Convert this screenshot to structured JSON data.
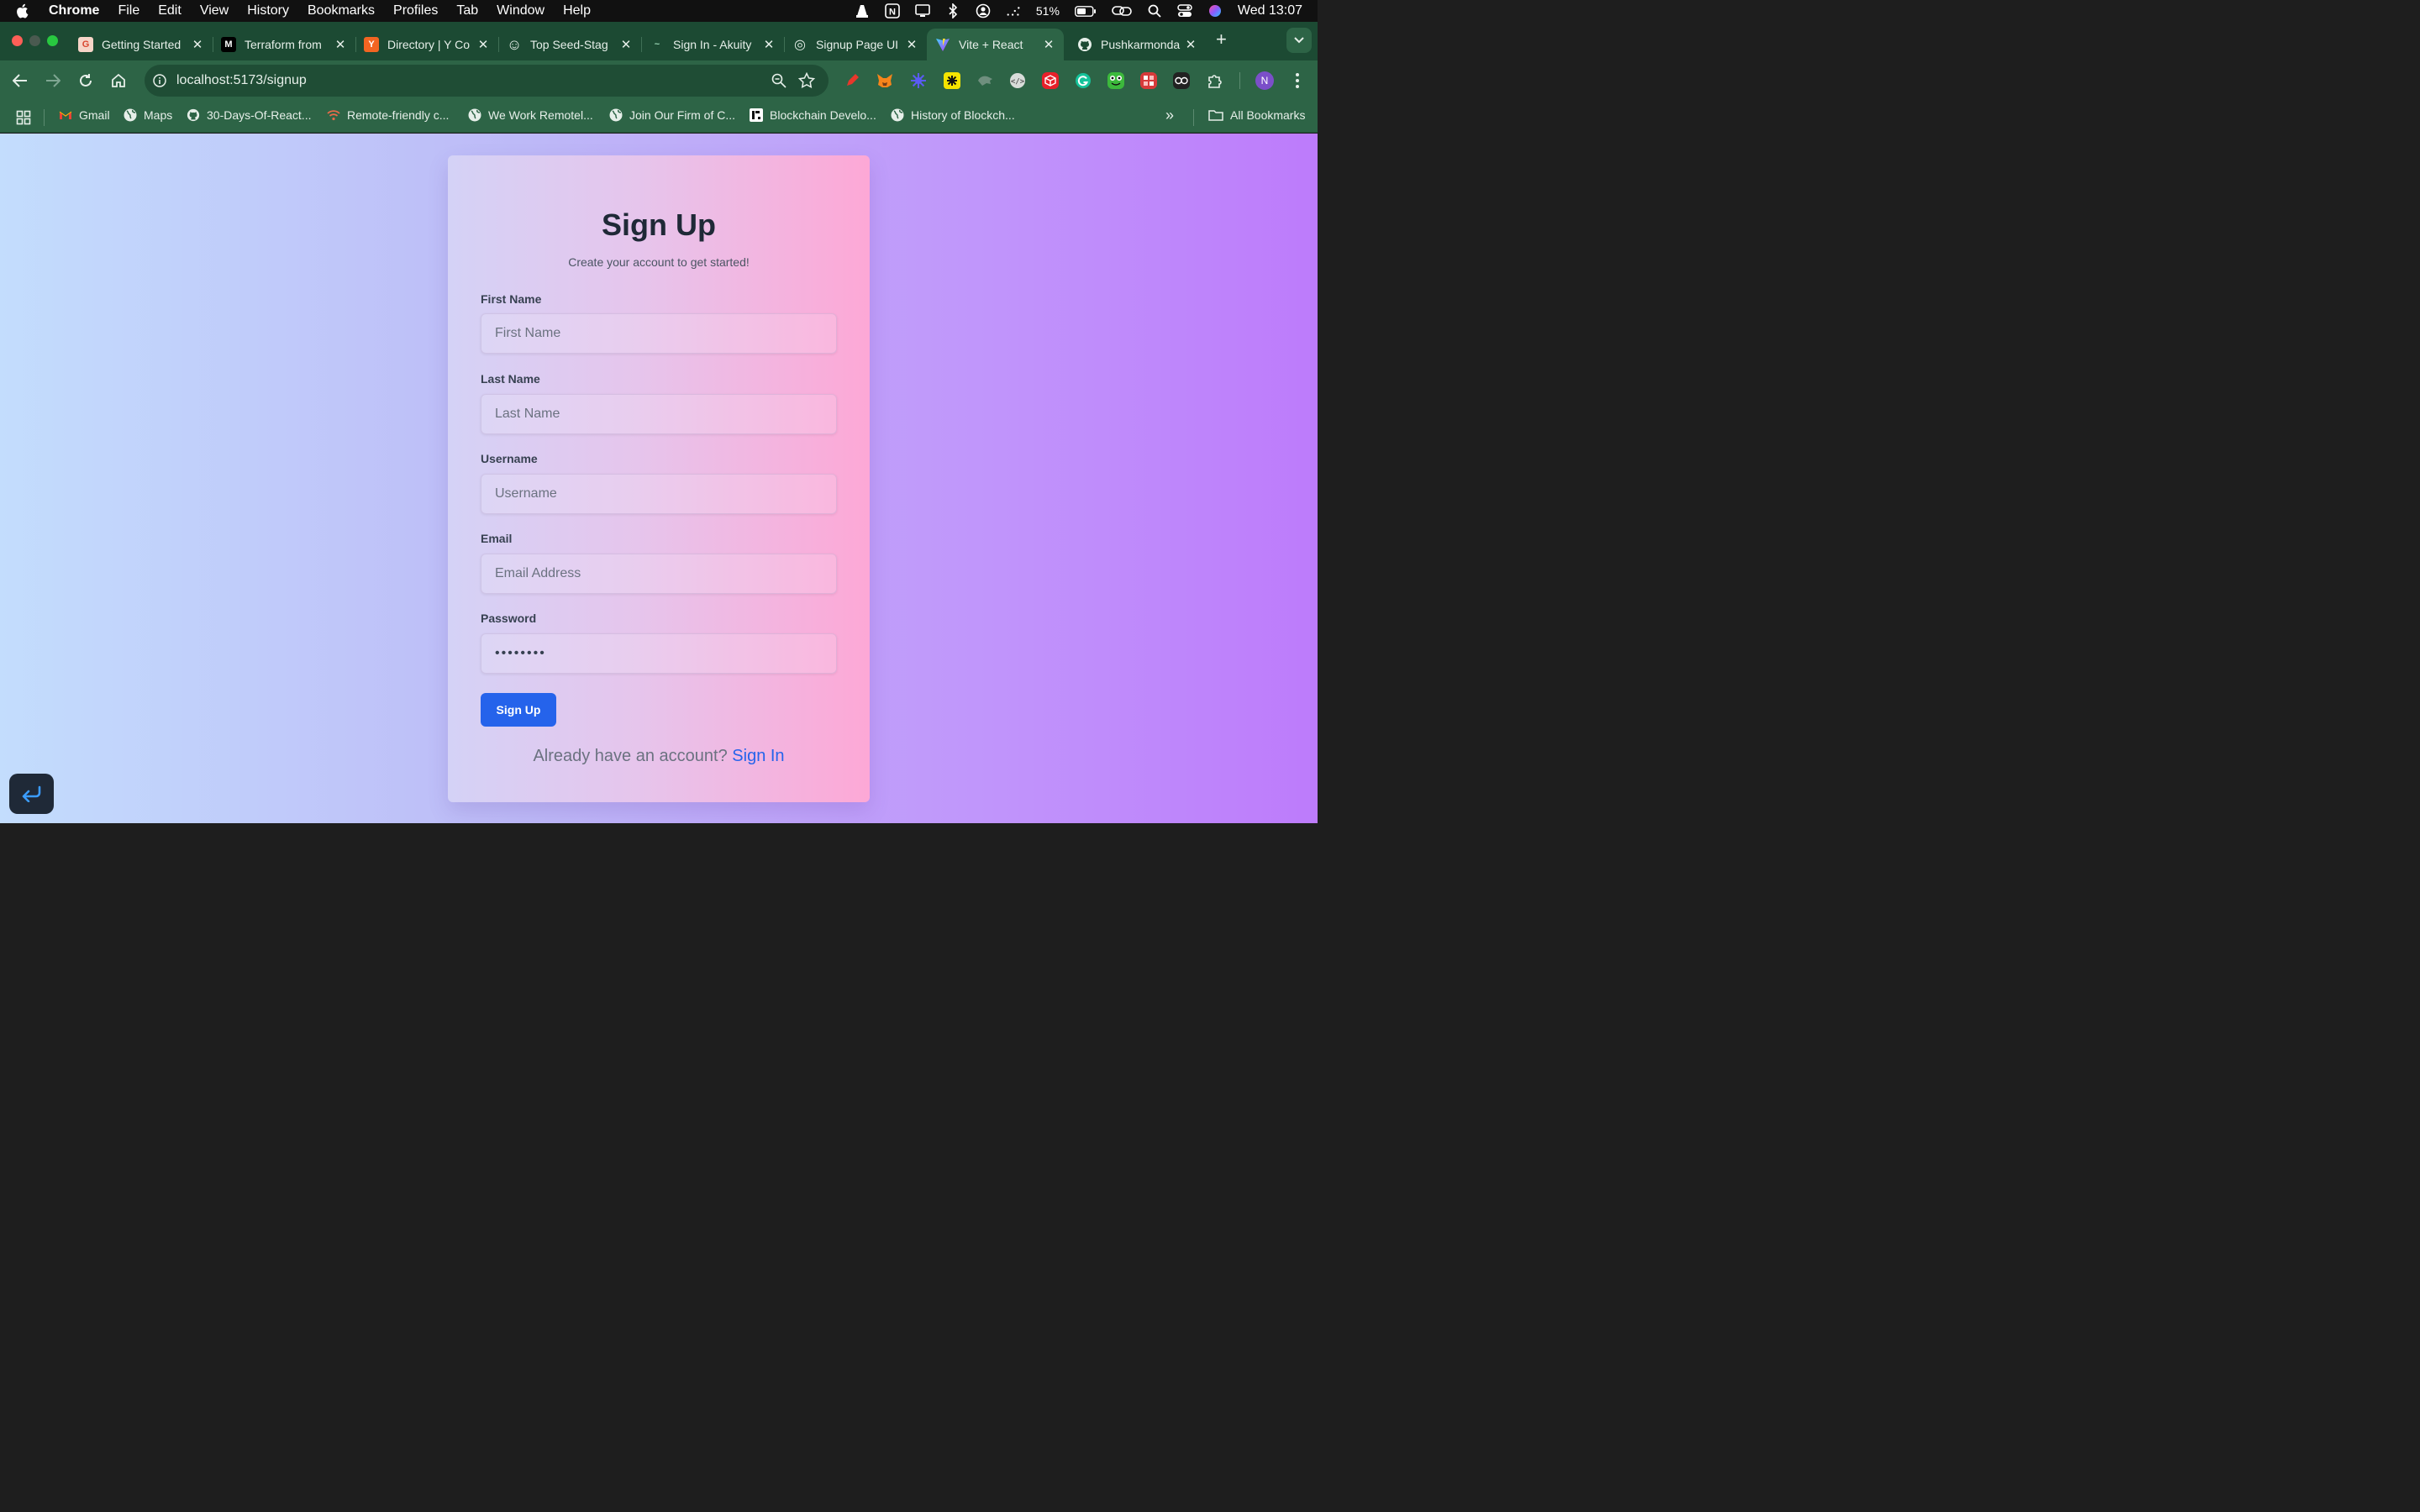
{
  "menubar": {
    "app": "Chrome",
    "items": [
      "File",
      "Edit",
      "View",
      "History",
      "Bookmarks",
      "Profiles",
      "Tab",
      "Window",
      "Help"
    ],
    "battery": "51%",
    "clock": "Wed 13:07"
  },
  "tabs": [
    {
      "label": "Getting Started",
      "favicon": "G"
    },
    {
      "label": "Terraform from",
      "favicon": "M"
    },
    {
      "label": "Directory | Y Co",
      "favicon": "Y"
    },
    {
      "label": "Top Seed-Stag",
      "favicon": "☺"
    },
    {
      "label": "Sign In - Akuity",
      "favicon": "~"
    },
    {
      "label": "Signup Page UI",
      "favicon": "◎"
    },
    {
      "label": "Vite + React",
      "favicon": "V"
    },
    {
      "label": "Pushkarmonda",
      "favicon": "◉"
    }
  ],
  "toolbar": {
    "url": "localhost:5173/signup",
    "profile_initial": "N"
  },
  "bookmarks": {
    "items": [
      "Gmail",
      "Maps",
      "30-Days-Of-React...",
      "Remote-friendly c...",
      "We Work Remotel...",
      "Join Our Firm of C...",
      "Blockchain Develo...",
      "History of Blockch..."
    ],
    "overflow": "»",
    "all_bookmarks": "All Bookmarks"
  },
  "form": {
    "title": "Sign Up",
    "subtitle": "Create your account to get started!",
    "first_name_label": "First Name",
    "first_name_placeholder": "First Name",
    "last_name_label": "Last Name",
    "last_name_placeholder": "Last Name",
    "username_label": "Username",
    "username_placeholder": "Username",
    "email_label": "Email",
    "email_placeholder": "Email Address",
    "password_label": "Password",
    "password_value": "••••••••",
    "submit_label": "Sign Up",
    "signin_prompt": "Already have an account?",
    "signin_link": "Sign In"
  },
  "colors": {
    "accent": "#2563eb",
    "chrome_theme": "#2d6446",
    "page_gradient_start": "#c3ddfd",
    "page_gradient_end": "#bd7bfb"
  }
}
